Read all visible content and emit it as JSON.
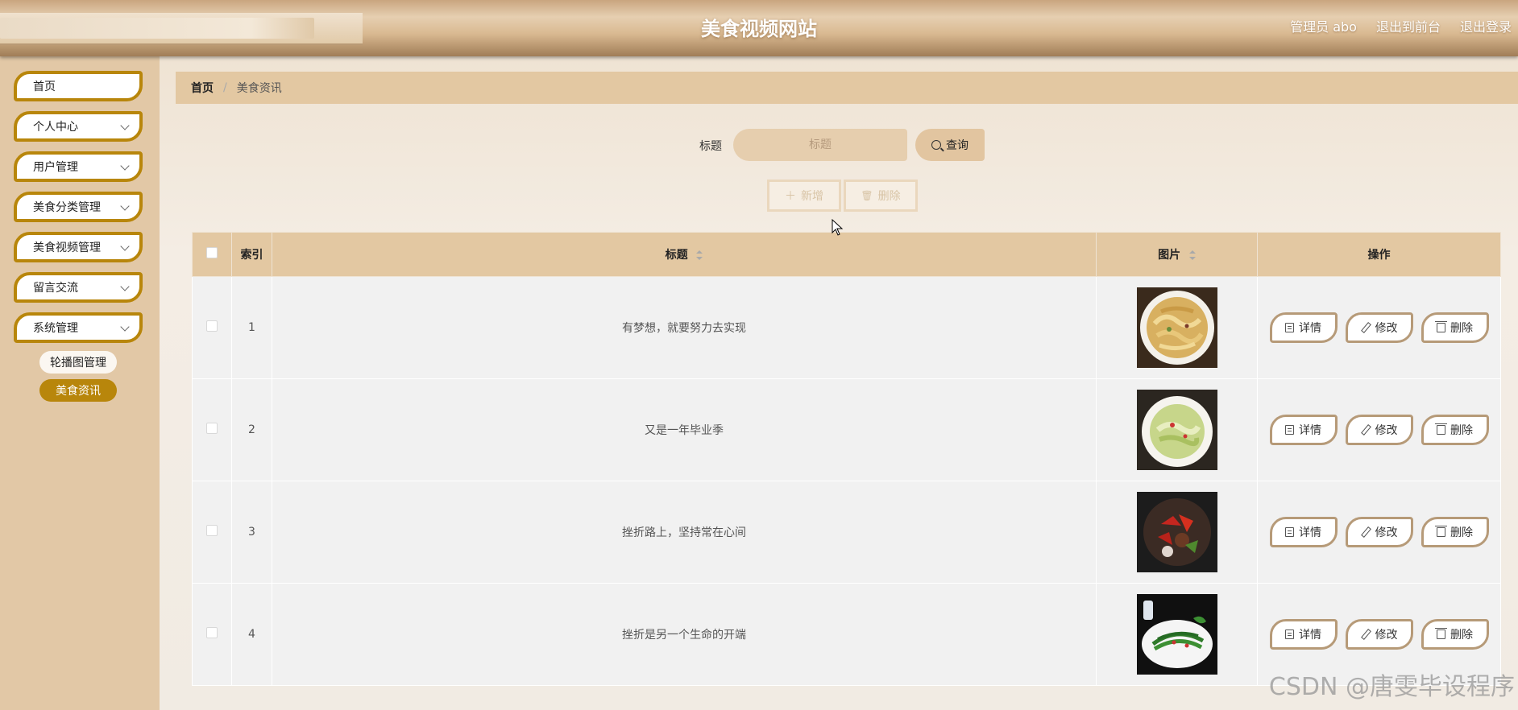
{
  "header": {
    "site_title": "美食视频网站",
    "admin_label": "管理员 abo",
    "back_front": "退出到前台",
    "logout": "退出登录"
  },
  "sidebar": {
    "items": [
      {
        "label": "首页",
        "has_children": false
      },
      {
        "label": "个人中心",
        "has_children": true
      },
      {
        "label": "用户管理",
        "has_children": true
      },
      {
        "label": "美食分类管理",
        "has_children": true
      },
      {
        "label": "美食视频管理",
        "has_children": true
      },
      {
        "label": "留言交流",
        "has_children": true
      },
      {
        "label": "系统管理",
        "has_children": true
      }
    ],
    "sub_items": [
      {
        "label": "轮播图管理",
        "active": false
      },
      {
        "label": "美食资讯",
        "active": true
      }
    ],
    "accent_color": "#b8860b"
  },
  "breadcrumb": {
    "home": "首页",
    "separator": "/",
    "current": "美食资讯"
  },
  "search": {
    "label": "标题",
    "placeholder": "标题",
    "button_label": "查询"
  },
  "actions": {
    "add_label": "新增",
    "delete_label": "删除"
  },
  "table": {
    "headers": {
      "index": "索引",
      "title": "标题",
      "image": "图片",
      "operation": "操作"
    },
    "rows": [
      {
        "index": "1",
        "title": "有梦想，就要努力去实现",
        "image": "pasta-dish-icon"
      },
      {
        "index": "2",
        "title": "又是一年毕业季",
        "image": "cabbage-dish-icon"
      },
      {
        "index": "3",
        "title": "挫折路上，坚持常在心间",
        "image": "pepper-meat-dish-icon"
      },
      {
        "index": "4",
        "title": "挫折是另一个生命的开端",
        "image": "green-bean-dish-icon"
      }
    ],
    "row_buttons": {
      "detail": "详情",
      "edit": "修改",
      "delete": "删除"
    }
  },
  "watermark": "CSDN @唐雯毕设程序"
}
